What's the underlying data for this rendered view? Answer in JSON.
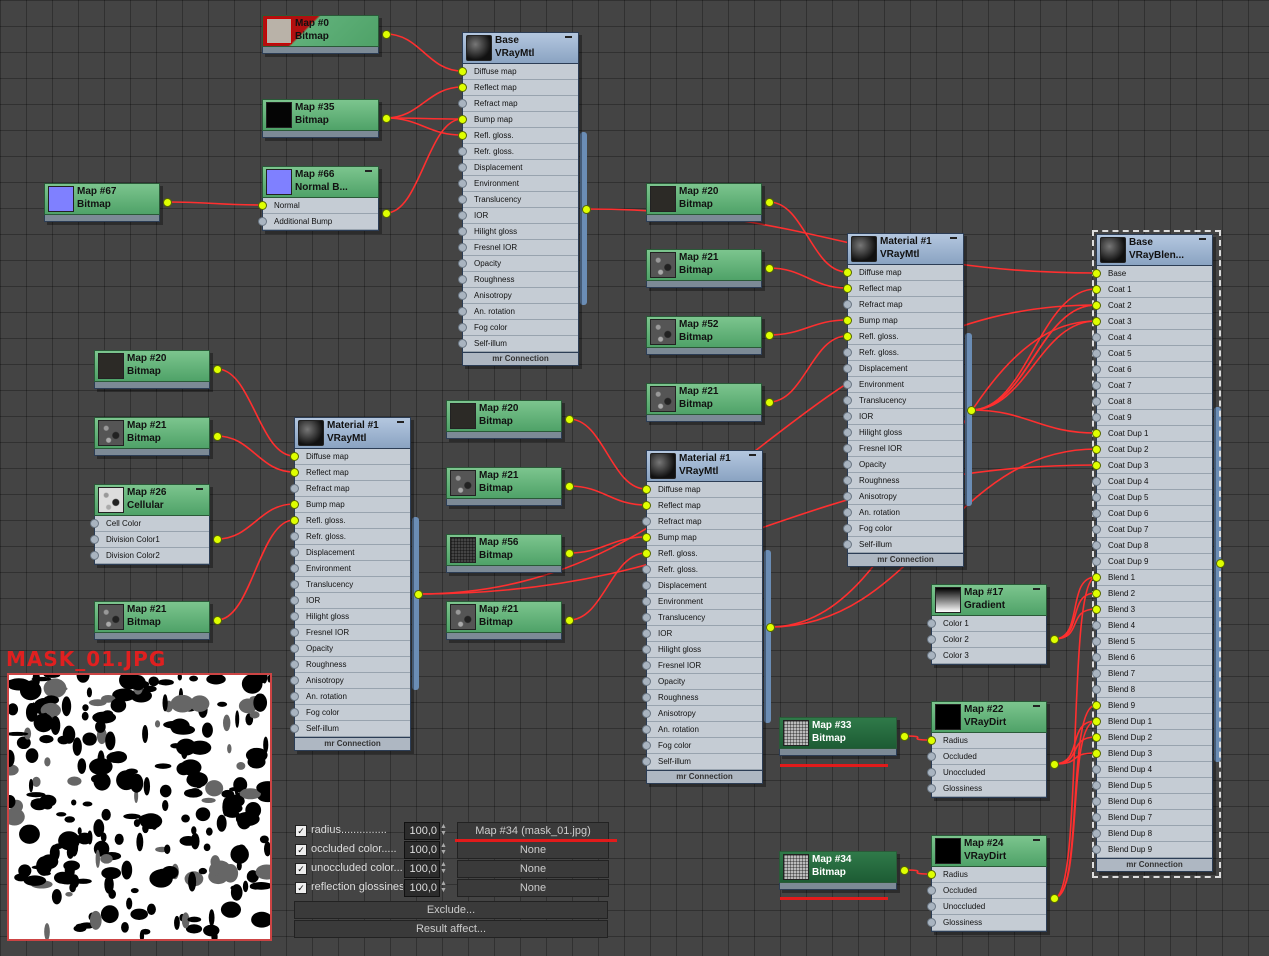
{
  "colors": {
    "wire": "#ff2f2f",
    "map_header": "#5fb079",
    "material_header": "#9fb5d2",
    "socket": "#dfff00",
    "highlight": "#e21b1b"
  },
  "nodes": {
    "m0": {
      "name": "Map #0",
      "type": "Bitmap"
    },
    "m35": {
      "name": "Map #35",
      "type": "Bitmap"
    },
    "m66": {
      "name": "Map #66",
      "type": "Normal B...",
      "slots": [
        "Normal",
        "Additional Bump"
      ]
    },
    "m67": {
      "name": "Map #67",
      "type": "Bitmap"
    },
    "base": {
      "name": "Base",
      "type": "VRayMtl",
      "footer": "mr Connection"
    },
    "l20": {
      "name": "Map #20",
      "type": "Bitmap"
    },
    "l21a": {
      "name": "Map #21",
      "type": "Bitmap"
    },
    "m26": {
      "name": "Map #26",
      "type": "Cellular",
      "slots": [
        "Cell Color",
        "Division Color1",
        "Division Color2"
      ]
    },
    "l21b": {
      "name": "Map #21",
      "type": "Bitmap"
    },
    "matL": {
      "name": "Material #1",
      "type": "VRayMtl",
      "footer": "mr Connection"
    },
    "c20": {
      "name": "Map #20",
      "type": "Bitmap"
    },
    "c21a": {
      "name": "Map #21",
      "type": "Bitmap"
    },
    "c56": {
      "name": "Map #56",
      "type": "Bitmap"
    },
    "c21b": {
      "name": "Map #21",
      "type": "Bitmap"
    },
    "matM": {
      "name": "Material #1",
      "type": "VRayMtl",
      "footer": "mr Connection"
    },
    "r20": {
      "name": "Map #20",
      "type": "Bitmap"
    },
    "r21a": {
      "name": "Map #21",
      "type": "Bitmap"
    },
    "r52": {
      "name": "Map #52",
      "type": "Bitmap"
    },
    "r21b": {
      "name": "Map #21",
      "type": "Bitmap"
    },
    "matR": {
      "name": "Material #1",
      "type": "VRayMtl",
      "footer": "mr Connection"
    },
    "m17": {
      "name": "Map #17",
      "type": "Gradient",
      "slots": [
        "Color 1",
        "Color 2",
        "Color 3"
      ]
    },
    "m22": {
      "name": "Map #22",
      "type": "VRayDirt",
      "slots": [
        "Radius",
        "Occluded",
        "Unoccluded",
        "Glossiness"
      ]
    },
    "m24": {
      "name": "Map #24",
      "type": "VRayDirt",
      "slots": [
        "Radius",
        "Occluded",
        "Unoccluded",
        "Glossiness"
      ]
    },
    "m33": {
      "name": "Map #33",
      "type": "Bitmap"
    },
    "m34": {
      "name": "Map #34",
      "type": "Bitmap"
    },
    "blend": {
      "name": "Base",
      "type": "VRayBlen...",
      "footer": "mr Connection"
    }
  },
  "vray_slots": [
    "Diffuse map",
    "Reflect map",
    "Refract map",
    "Bump map",
    "Refl. gloss.",
    "Refr. gloss.",
    "Displacement",
    "Environment",
    "Translucency",
    "IOR",
    "Hilight gloss",
    "Fresnel IOR",
    "Opacity",
    "Roughness",
    "Anisotropy",
    "An. rotation",
    "Fog color",
    "Self-illum"
  ],
  "blend_slots": [
    "Base",
    "Coat 1",
    "Coat 2",
    "Coat 3",
    "Coat 4",
    "Coat 5",
    "Coat 6",
    "Coat 7",
    "Coat 8",
    "Coat 9",
    "Coat Dup 1",
    "Coat Dup 2",
    "Coat Dup 3",
    "Coat Dup 4",
    "Coat Dup 5",
    "Coat Dup 6",
    "Coat Dup 7",
    "Coat Dup 8",
    "Coat Dup 9",
    "Blend 1",
    "Blend 2",
    "Blend 3",
    "Blend 4",
    "Blend 5",
    "Blend 6",
    "Blend 7",
    "Blend 8",
    "Blend 9",
    "Blend Dup 1",
    "Blend Dup 2",
    "Blend Dup 3",
    "Blend Dup 4",
    "Blend Dup 5",
    "Blend Dup 6",
    "Blend Dup 7",
    "Blend Dup 8",
    "Blend Dup 9"
  ],
  "mask": {
    "title": "MASK_01.JPG"
  },
  "params": {
    "rows": [
      {
        "label": "radius...............",
        "value": "100,0",
        "map": "Map #34 (mask_01.jpg)"
      },
      {
        "label": "occluded color.....",
        "value": "100,0",
        "map": "None"
      },
      {
        "label": "unoccluded color....",
        "value": "100,0",
        "map": "None"
      },
      {
        "label": "reflection glossines",
        "value": "100,0",
        "map": "None"
      }
    ],
    "exclude": "Exclude...",
    "result_affect": "Result affect..."
  }
}
